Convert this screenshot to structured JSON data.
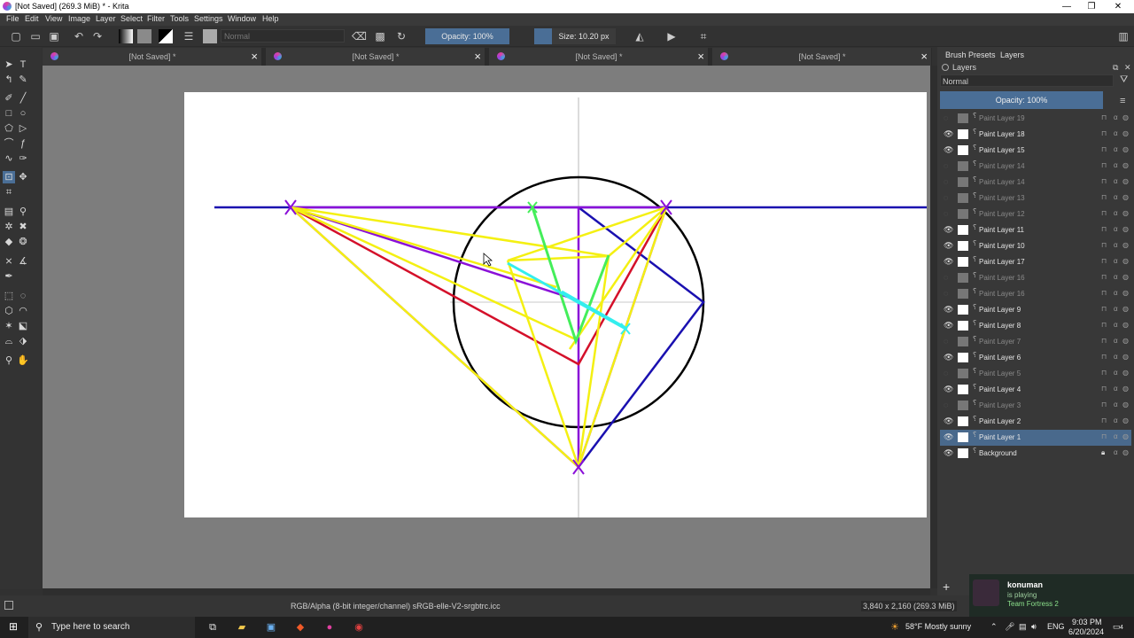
{
  "window": {
    "title": "[Not Saved]  (269.3 MiB)  * - Krita",
    "minimize": "—",
    "maximize": "❐",
    "close": "✕"
  },
  "menu": [
    "File",
    "Edit",
    "View",
    "Image",
    "Layer",
    "Select",
    "Filter",
    "Tools",
    "Settings",
    "Window",
    "Help"
  ],
  "toolbar": {
    "blend_mode": "Normal",
    "opacity": "Opacity: 100%",
    "size": "Size: 10.20 px"
  },
  "tabs": [
    {
      "label": "[Not Saved]  *"
    },
    {
      "label": "[Not Saved]  *"
    },
    {
      "label": "[Not Saved]  *"
    },
    {
      "label": "[Not Saved]  *"
    }
  ],
  "dock": {
    "tab_brush_presets": "Brush Presets",
    "tab_layers": "Layers",
    "panel_title": "Layers",
    "blend_mode": "Normal",
    "opacity": "Opacity:  100%",
    "layers": [
      {
        "name": "Paint Layer 19",
        "visible": false
      },
      {
        "name": "Paint Layer 18",
        "visible": true
      },
      {
        "name": "Paint Layer 15",
        "visible": true
      },
      {
        "name": "Paint Layer 14",
        "visible": false
      },
      {
        "name": "Paint Layer 14",
        "visible": false
      },
      {
        "name": "Paint Layer 13",
        "visible": false
      },
      {
        "name": "Paint Layer 12",
        "visible": false
      },
      {
        "name": "Paint Layer 11",
        "visible": true
      },
      {
        "name": "Paint Layer 10",
        "visible": true
      },
      {
        "name": "Paint Layer 17",
        "visible": true
      },
      {
        "name": "Paint Layer 16",
        "visible": false
      },
      {
        "name": "Paint Layer 16",
        "visible": false
      },
      {
        "name": "Paint Layer 9",
        "visible": true
      },
      {
        "name": "Paint Layer 8",
        "visible": true
      },
      {
        "name": "Paint Layer 7",
        "visible": false
      },
      {
        "name": "Paint Layer 6",
        "visible": true
      },
      {
        "name": "Paint Layer 5",
        "visible": false
      },
      {
        "name": "Paint Layer 4",
        "visible": true
      },
      {
        "name": "Paint Layer 3",
        "visible": false
      },
      {
        "name": "Paint Layer 2",
        "visible": true
      },
      {
        "name": "Paint Layer 1",
        "visible": true,
        "selected": true
      },
      {
        "name": "Background",
        "visible": true,
        "locked": true
      }
    ]
  },
  "status": {
    "color_info": "RGB/Alpha (8-bit integer/channel)  sRGB-elle-V2-srgbtrc.icc",
    "dimensions": "3,840 x 2,160 (269.3 MiB)"
  },
  "stream": {
    "user": "konuman",
    "status": "is playing",
    "game": "Team Fortress 2"
  },
  "taskbar": {
    "search_placeholder": "Type here to search",
    "weather": "58°F  Mostly sunny",
    "lang": "ENG",
    "time": "9:03 PM",
    "date": "6/20/2024",
    "notifications": "4"
  }
}
